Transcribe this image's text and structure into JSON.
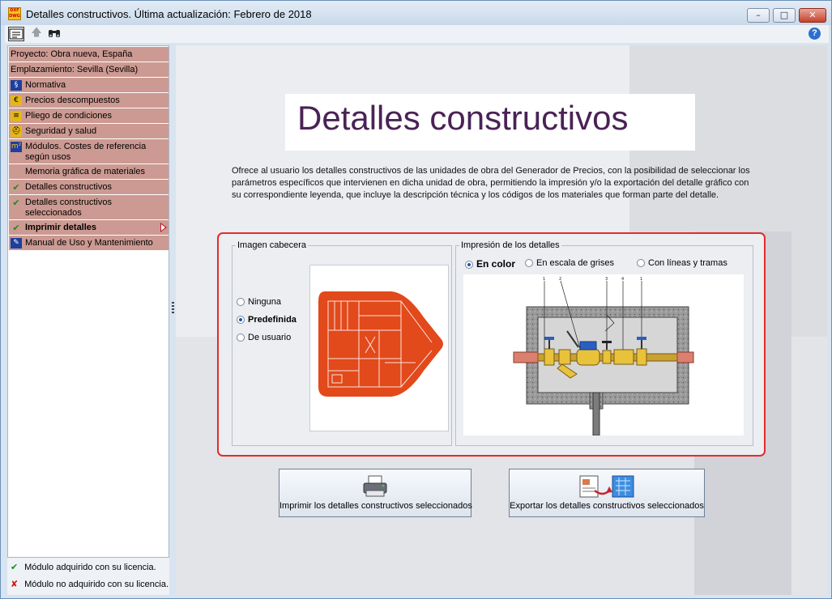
{
  "window": {
    "title": "Detalles constructivos. Última actualización: Febrero de 2018",
    "app_icon_text": "DXF DWG",
    "controls": {
      "minimize": "–",
      "maximize": "□",
      "close": "✕"
    }
  },
  "toolbar": {
    "help": "?"
  },
  "sidebar": {
    "items": [
      {
        "label": "Proyecto: Obra nueva, España",
        "icon": "none",
        "selected": false
      },
      {
        "label": "Emplazamiento: Sevilla (Sevilla)",
        "icon": "none",
        "selected": false
      },
      {
        "label": "Normativa",
        "icon": "normativa-icon",
        "selected": false
      },
      {
        "label": "Precios descompuestos",
        "icon": "precios-icon",
        "selected": false
      },
      {
        "label": "Pliego de condiciones",
        "icon": "pliego-icon",
        "selected": false
      },
      {
        "label": "Seguridad y salud",
        "icon": "helmet-icon",
        "selected": false
      },
      {
        "label": "Módulos. Costes de referencia según usos",
        "icon": "m2-icon",
        "selected": false
      },
      {
        "label": "Memoria gráfica de materiales",
        "icon": "none",
        "selected": false
      },
      {
        "label": "Detalles constructivos",
        "icon": "check-icon",
        "selected": false
      },
      {
        "label": "Detalles constructivos seleccionados",
        "icon": "check-icon",
        "selected": false
      },
      {
        "label": "Imprimir detalles",
        "icon": "check-icon",
        "selected": true
      },
      {
        "label": "Manual de Uso y Mantenimiento",
        "icon": "manual-icon",
        "selected": false
      }
    ],
    "legend": {
      "acquired": "Módulo adquirido con su licencia.",
      "not_acquired": "Módulo no adquirido con su licencia."
    }
  },
  "main": {
    "heading": "Detalles constructivos",
    "description": "Ofrece al usuario los detalles constructivos de las unidades de obra del Generador de Precios, con la posibilidad de seleccionar los parámetros específicos que intervienen en dicha unidad de obra, permitiendo la impresión y/o la exportación del detalle gráfico con su correspondiente leyenda, que incluye la descripción técnica y los códigos de los materiales que forman parte del detalle.",
    "imagen_cabecera": {
      "title": "Imagen cabecera",
      "options": [
        "Ninguna",
        "Predefinida",
        "De usuario"
      ],
      "selected": "Predefinida"
    },
    "impresion": {
      "title": "Impresión de los detalles",
      "options": [
        "En color",
        "En escala de grises",
        "Con líneas y tramas"
      ],
      "selected": "En color",
      "callout_labels": [
        "1",
        "2",
        "3",
        "4",
        "1"
      ]
    },
    "buttons": {
      "print": "Imprimir los detalles constructivos seleccionados",
      "export": "Exportar los detalles constructivos seleccionados"
    }
  },
  "colors": {
    "nav_background": "#cc9a92",
    "frame_red": "#e52b2b",
    "heading_purple": "#4a2256",
    "logo_orange": "#e2491b"
  }
}
